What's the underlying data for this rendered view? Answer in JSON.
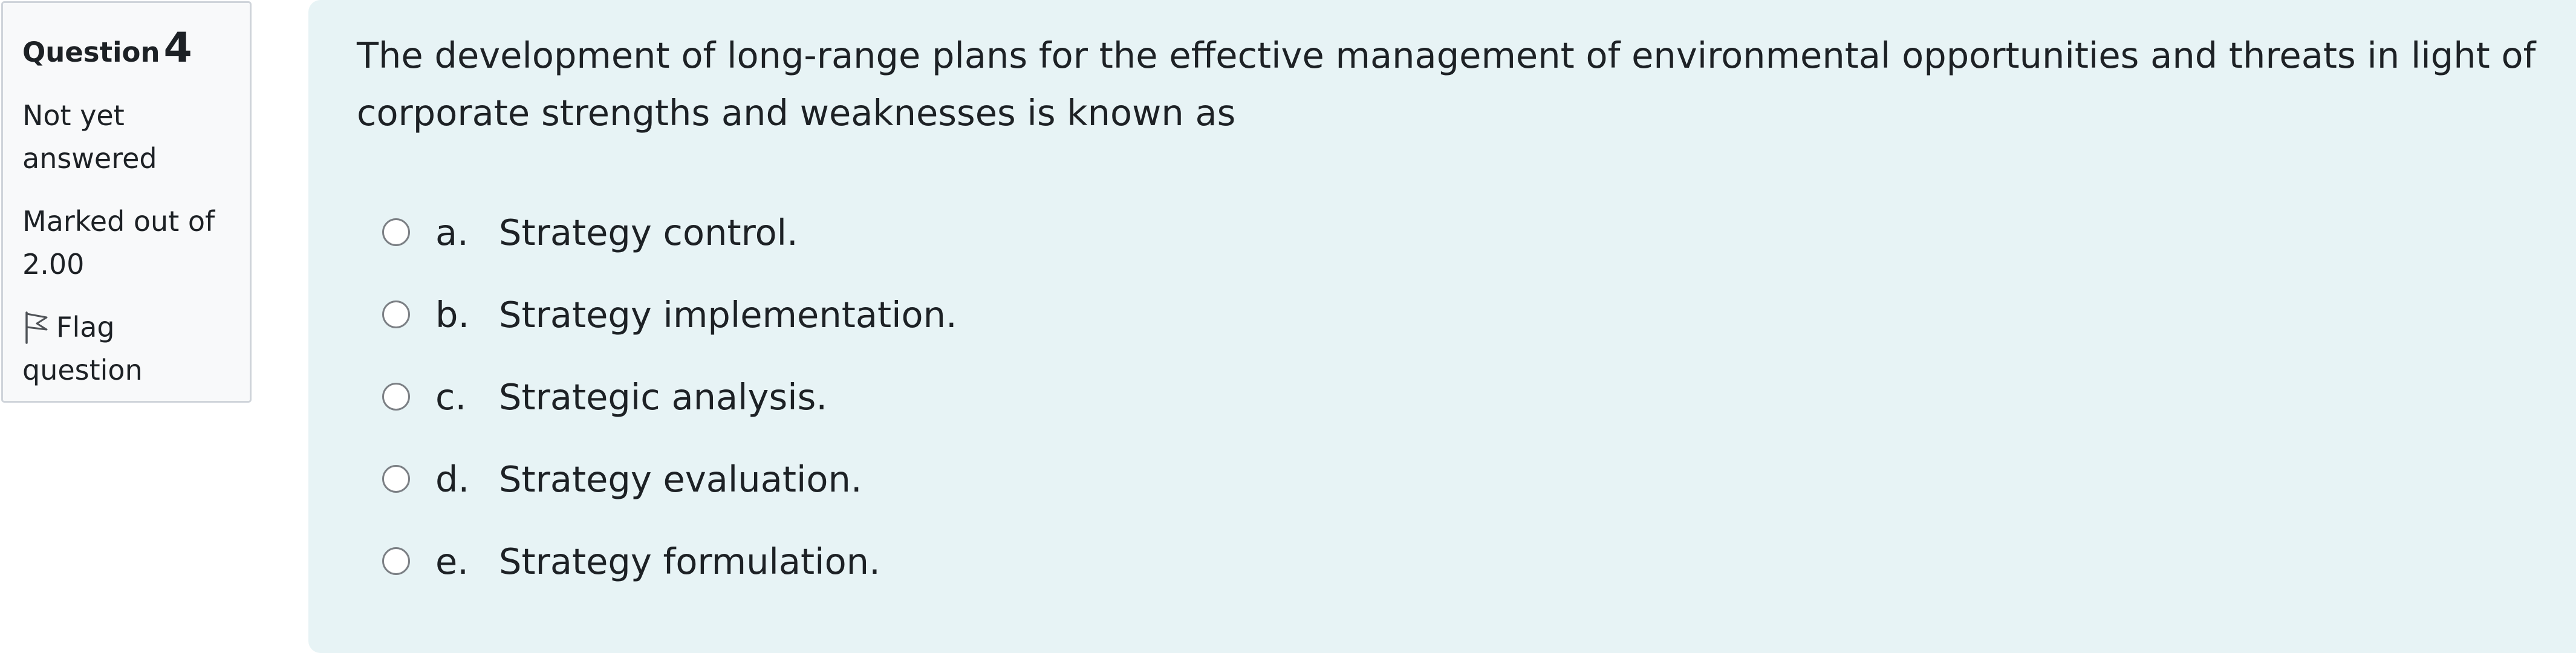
{
  "question_info": {
    "label": "Question",
    "number": "4",
    "state_line1": "Not yet",
    "state_line2": "answered",
    "grade_line1": "Marked out of",
    "grade_line2": "2.00",
    "flag_line1": "Flag",
    "flag_line2": "question",
    "flag_icon": "flag-outline-icon"
  },
  "question": {
    "text": "The development of long-range plans for the effective management of environmental opportunities and threats in light of corporate strengths and weaknesses is known as",
    "answers": [
      {
        "letter": "a.",
        "text": "Strategy control."
      },
      {
        "letter": "b.",
        "text": "Strategy implementation."
      },
      {
        "letter": "c.",
        "text": "Strategic analysis."
      },
      {
        "letter": "d.",
        "text": "Strategy evaluation."
      },
      {
        "letter": "e.",
        "text": "Strategy formulation."
      }
    ]
  },
  "colors": {
    "content_background": "#e7f3f5",
    "info_background": "#f8f9fa",
    "info_border": "#cfd4da",
    "text": "#1d2125",
    "radio_border": "#7b7f84"
  }
}
